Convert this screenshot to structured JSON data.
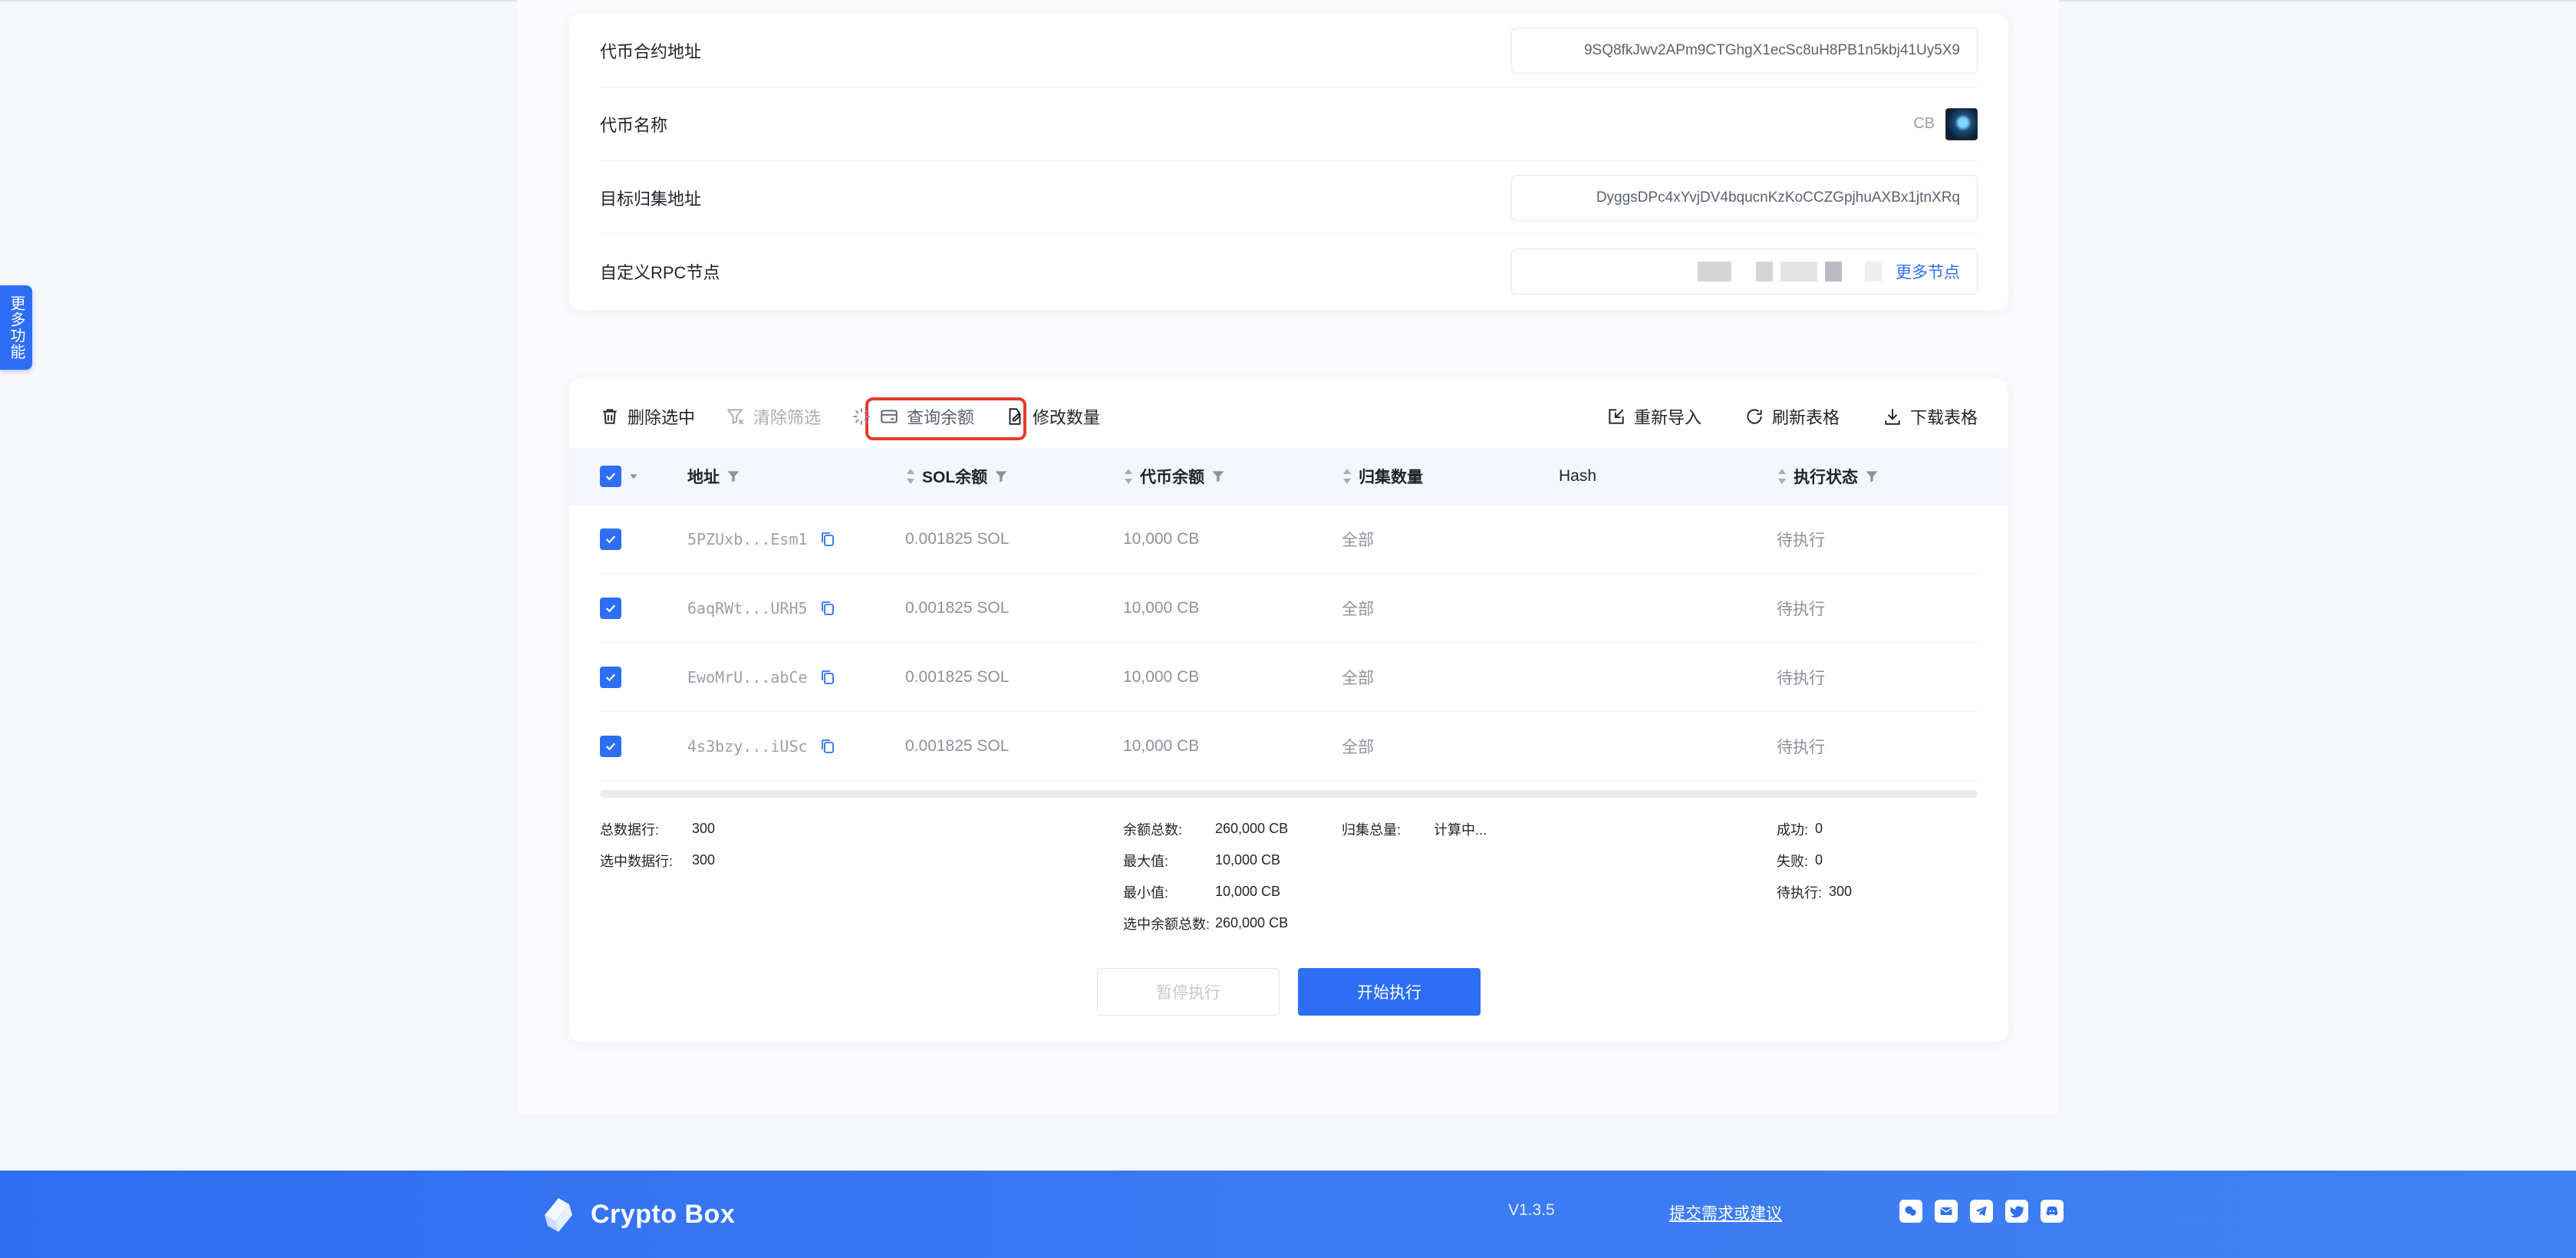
{
  "side_tab": {
    "label": "更多功能"
  },
  "config": {
    "contract": {
      "label": "代币合约地址",
      "value": "9SQ8fkJwv2APm9CTGhgX1ecSc8uH8PB1n5kbj41Uy5X9"
    },
    "name": {
      "label": "代币名称",
      "value": "CB"
    },
    "target": {
      "label": "目标归集地址",
      "value": "DyggsDPc4xYvjDV4bqucnKzKoCCZGpjhuAXBx1jtnXRq"
    },
    "rpc": {
      "label": "自定义RPC节点",
      "more": "更多节点"
    }
  },
  "toolbar": {
    "delete": "删除选中",
    "clear_filter": "清除筛选",
    "query_balance": "查询余额",
    "edit_qty": "修改数量",
    "reimport": "重新导入",
    "refresh": "刷新表格",
    "download": "下载表格"
  },
  "table": {
    "headers": {
      "address": "地址",
      "sol": "SOL余额",
      "token": "代币余额",
      "agg": "归集数量",
      "hash": "Hash",
      "status": "执行状态"
    },
    "rows": [
      {
        "address": "5PZUxb...Esm1",
        "sol": "0.001825 SOL",
        "token": "10,000 CB",
        "agg": "全部",
        "hash": "",
        "status": "待执行"
      },
      {
        "address": "6aqRWt...URH5",
        "sol": "0.001825 SOL",
        "token": "10,000 CB",
        "agg": "全部",
        "hash": "",
        "status": "待执行"
      },
      {
        "address": "EwoMrU...abCe",
        "sol": "0.001825 SOL",
        "token": "10,000 CB",
        "agg": "全部",
        "hash": "",
        "status": "待执行"
      },
      {
        "address": "4s3bzy...iUSc",
        "sol": "0.001825 SOL",
        "token": "10,000 CB",
        "agg": "全部",
        "hash": "",
        "status": "待执行"
      }
    ]
  },
  "summary": {
    "total_rows": {
      "k": "总数据行:",
      "v": "300"
    },
    "selected_rows": {
      "k": "选中数据行:",
      "v": "300"
    },
    "balance_total": {
      "k": "余额总数:",
      "v": "260,000 CB"
    },
    "max": {
      "k": "最大值:",
      "v": "10,000 CB"
    },
    "min": {
      "k": "最小值:",
      "v": "10,000 CB"
    },
    "selected_balance": {
      "k": "选中余额总数:",
      "v": "260,000 CB"
    },
    "agg_total": {
      "k": "归集总量:",
      "v": "计算中..."
    },
    "success": {
      "k": "成功:",
      "v": "0"
    },
    "fail": {
      "k": "失败:",
      "v": "0"
    },
    "pending": {
      "k": "待执行:",
      "v": "300"
    }
  },
  "actions": {
    "pause": "暂停执行",
    "start": "开始执行"
  },
  "footer": {
    "brand": "Crypto Box",
    "version": "V1.3.5",
    "feedback": "提交需求或建议",
    "socials": [
      "wechat-icon",
      "email-icon",
      "telegram-icon",
      "twitter-icon",
      "discord-icon"
    ]
  },
  "colors": {
    "accent": "#2d6ef5",
    "highlight": "#e33b2e",
    "footer": "#2e6ff2"
  }
}
